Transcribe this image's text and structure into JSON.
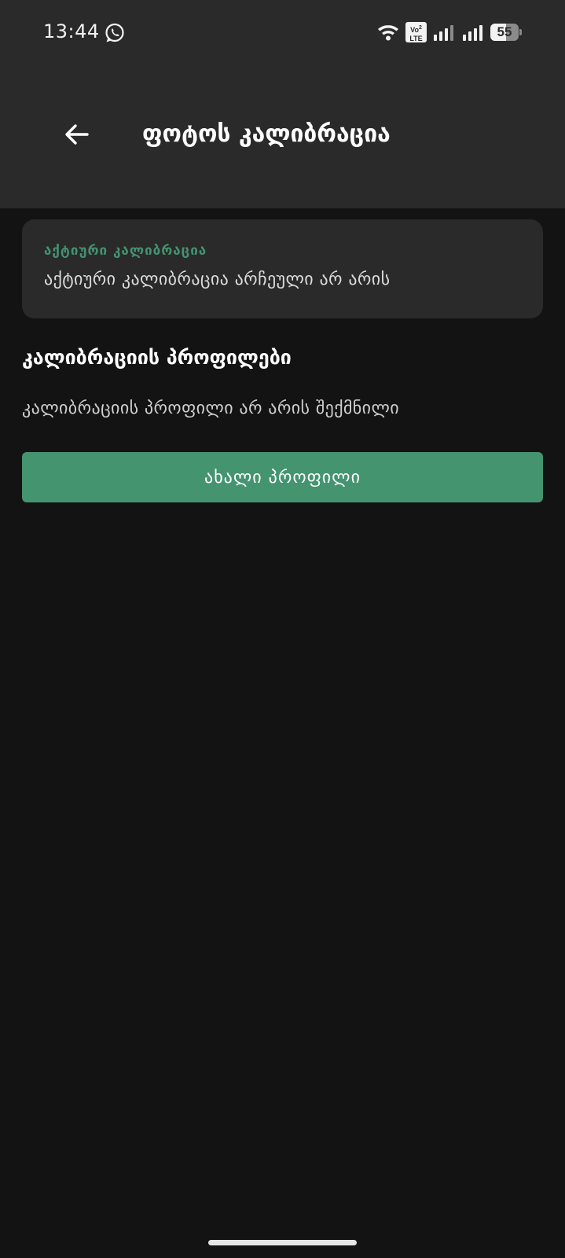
{
  "status_bar": {
    "time": "13:44",
    "notification_icons": [
      "whatsapp-icon"
    ],
    "system_icons": [
      "wifi-icon",
      "volte-icon",
      "signal-icon",
      "signal-icon",
      "battery-icon"
    ],
    "volte_line1": "Vo",
    "volte_sup": "2",
    "volte_line2": "LTE",
    "battery_level": "55",
    "battery_fraction": 0.55
  },
  "app_bar": {
    "back_icon": "arrow-left-icon",
    "title": "ფოტოს კალიბრაცია"
  },
  "active_calibration": {
    "label": "აქტიური კალიბრაცია",
    "value": "აქტიური კალიბრაცია არჩეული არ არის"
  },
  "profiles": {
    "title": "კალიბრაციის პროფილები",
    "empty_message": "კალიბრაციის პროფილი არ არის შექმნილი",
    "new_button_label": "ახალი პროფილი"
  },
  "colors": {
    "background": "#131313",
    "surface": "#2a2a2a",
    "accent": "#44946f",
    "text_primary": "#ffffff"
  }
}
